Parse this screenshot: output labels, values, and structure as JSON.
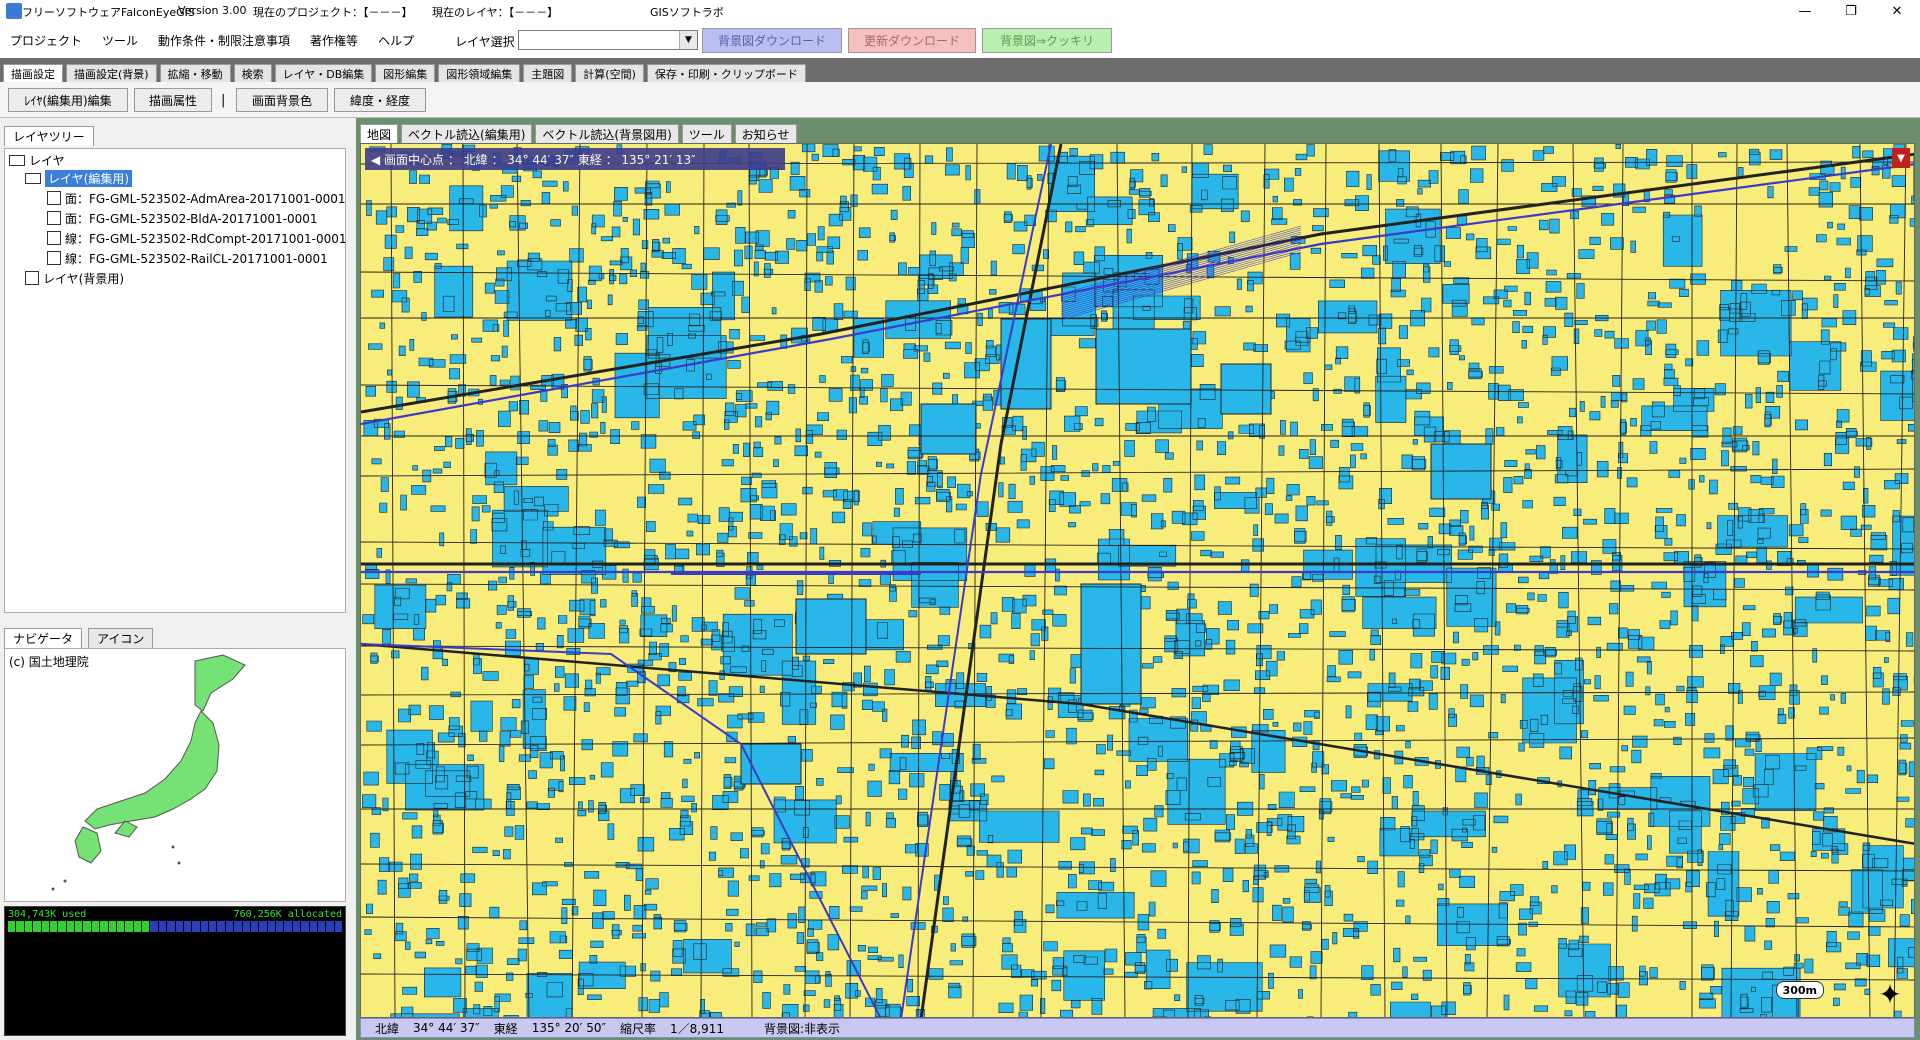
{
  "titlebar": {
    "app_name": "フリーソフトウェアFalconEyeGIS",
    "version": "Version 3.00",
    "project": "現在のプロジェクト：【－－－】",
    "layer": "現在のレイヤ：【－－－】",
    "lab": "GISソフトラボ",
    "minimize": "—",
    "maximize": "❐",
    "close": "✕"
  },
  "menubar": {
    "items": [
      "プロジェクト",
      "ツール",
      "動作条件・制限注意事項",
      "著作権等",
      "ヘルプ"
    ],
    "layer_select_label": "レイヤ選択",
    "layer_select_value": "",
    "bg_download": "背景図ダウンロード",
    "update_download": "更新ダウンロード",
    "bg_clear": "背景図⇒クッキリ"
  },
  "main_tabs": [
    "描画設定",
    "描画設定(背景)",
    "拡縮・移動",
    "検索",
    "レイヤ・DB編集",
    "図形編集",
    "図形領域編集",
    "主題図",
    "計算(空間)",
    "保存・印刷・クリップボード"
  ],
  "sub_toolbar": {
    "layer_edit": "ﾚｲﾔ(編集用)編集",
    "draw_attr": "描画属性",
    "separator": "|",
    "bg_color": "画面背景色",
    "latlon": "緯度・経度"
  },
  "layer_tree": {
    "tab": "レイヤツリー",
    "root": "レイヤ",
    "edit_layer": "レイヤ(編集用)",
    "files": [
      "面：FG-GML-523502-AdmArea-20171001-0001",
      "面：FG-GML-523502-BldA-20171001-0001",
      "線：FG-GML-523502-RdCompt-20171001-0001",
      "線：FG-GML-523502-RailCL-20171001-0001"
    ],
    "bg_layer": "レイヤ(背景用)"
  },
  "navigator": {
    "tabs": [
      "ナビゲータ",
      "アイコン"
    ],
    "credit": "(c) 国土地理院"
  },
  "memory": {
    "used": "304,743K used",
    "allocated": "760,256K allocated",
    "used_fraction": 0.42
  },
  "map_tabs": [
    "地図",
    "ベクトル読込(編集用)",
    "ベクトル読込(背景図用)",
    "ツール",
    "お知らせ"
  ],
  "map": {
    "center_label": "◀ 画面中心点 ： 北緯 ： 34° 44′ 37″ 東経 ： 135° 21′ 13″",
    "corner_arrow": "▼",
    "scale": "300m",
    "compass": "✦",
    "colors": {
      "land": "#f8ec7a",
      "building": "#29b6e8",
      "road": "#222222",
      "rail": "#3b3bc8"
    }
  },
  "statusbar": {
    "lat_label": "北緯",
    "lat": "34° 44′ 37″",
    "lon_label": "東経",
    "lon": "135° 20′ 50″",
    "scale_label": "縮尺率",
    "scale": "1／8,911",
    "bg_label": "背景図:非表示"
  }
}
